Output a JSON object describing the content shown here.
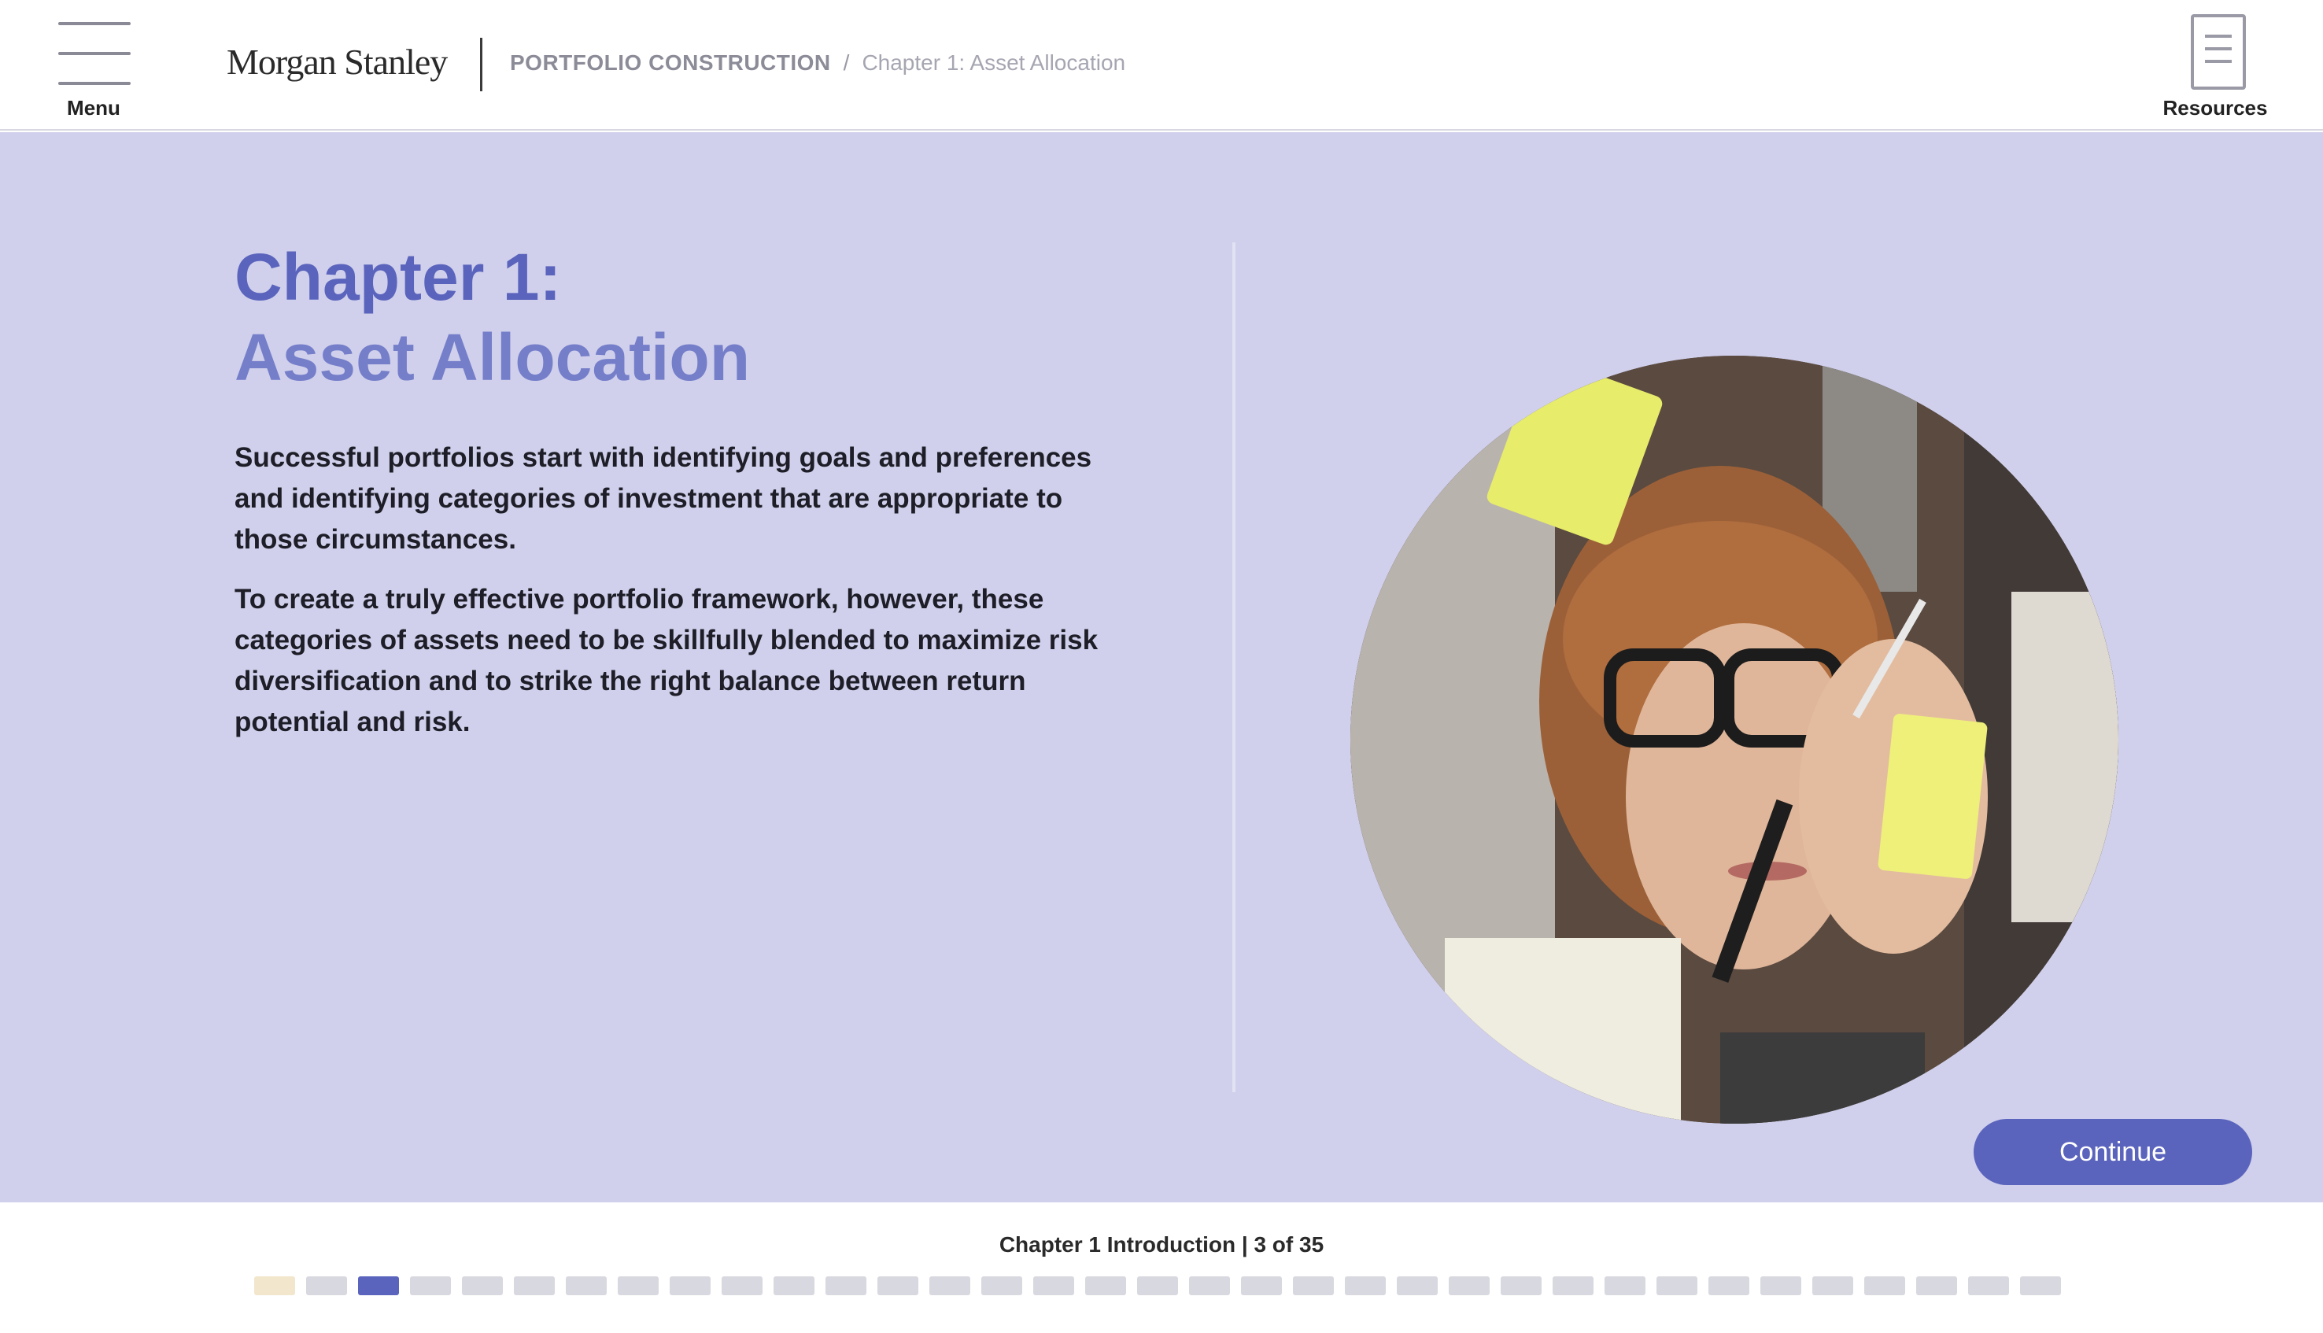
{
  "header": {
    "menu_label": "Menu",
    "logo_text": "Morgan Stanley",
    "breadcrumb_section": "PORTFOLIO CONSTRUCTION",
    "breadcrumb_separator": "/",
    "breadcrumb_page": "Chapter 1: Asset Allocation",
    "resources_label": "Resources"
  },
  "main": {
    "title_line1": "Chapter 1:",
    "title_line2": "Asset Allocation",
    "paragraph1": "Successful portfolios start with identifying goals and preferences and identifying categories of investment that are appropriate to those circumstances.",
    "paragraph2": "To create a truly effective portfolio framework, however, these categories of assets need to be skillfully blended to maximize risk diversification and to strike the right balance between return potential and risk.",
    "continue_label": "Continue"
  },
  "footer": {
    "progress_label": "Chapter 1 Introduction | 3 of 35",
    "current_page": 3,
    "total_pages": 35,
    "visited_pages": [
      1
    ]
  },
  "colors": {
    "accent": "#5b64bd",
    "content_bg": "#d0d0ec",
    "dot_inactive": "#d8d8e0",
    "dot_visited": "#f2e6cc"
  },
  "icons": {
    "menu": "hamburger-icon",
    "resources": "document-icon"
  }
}
